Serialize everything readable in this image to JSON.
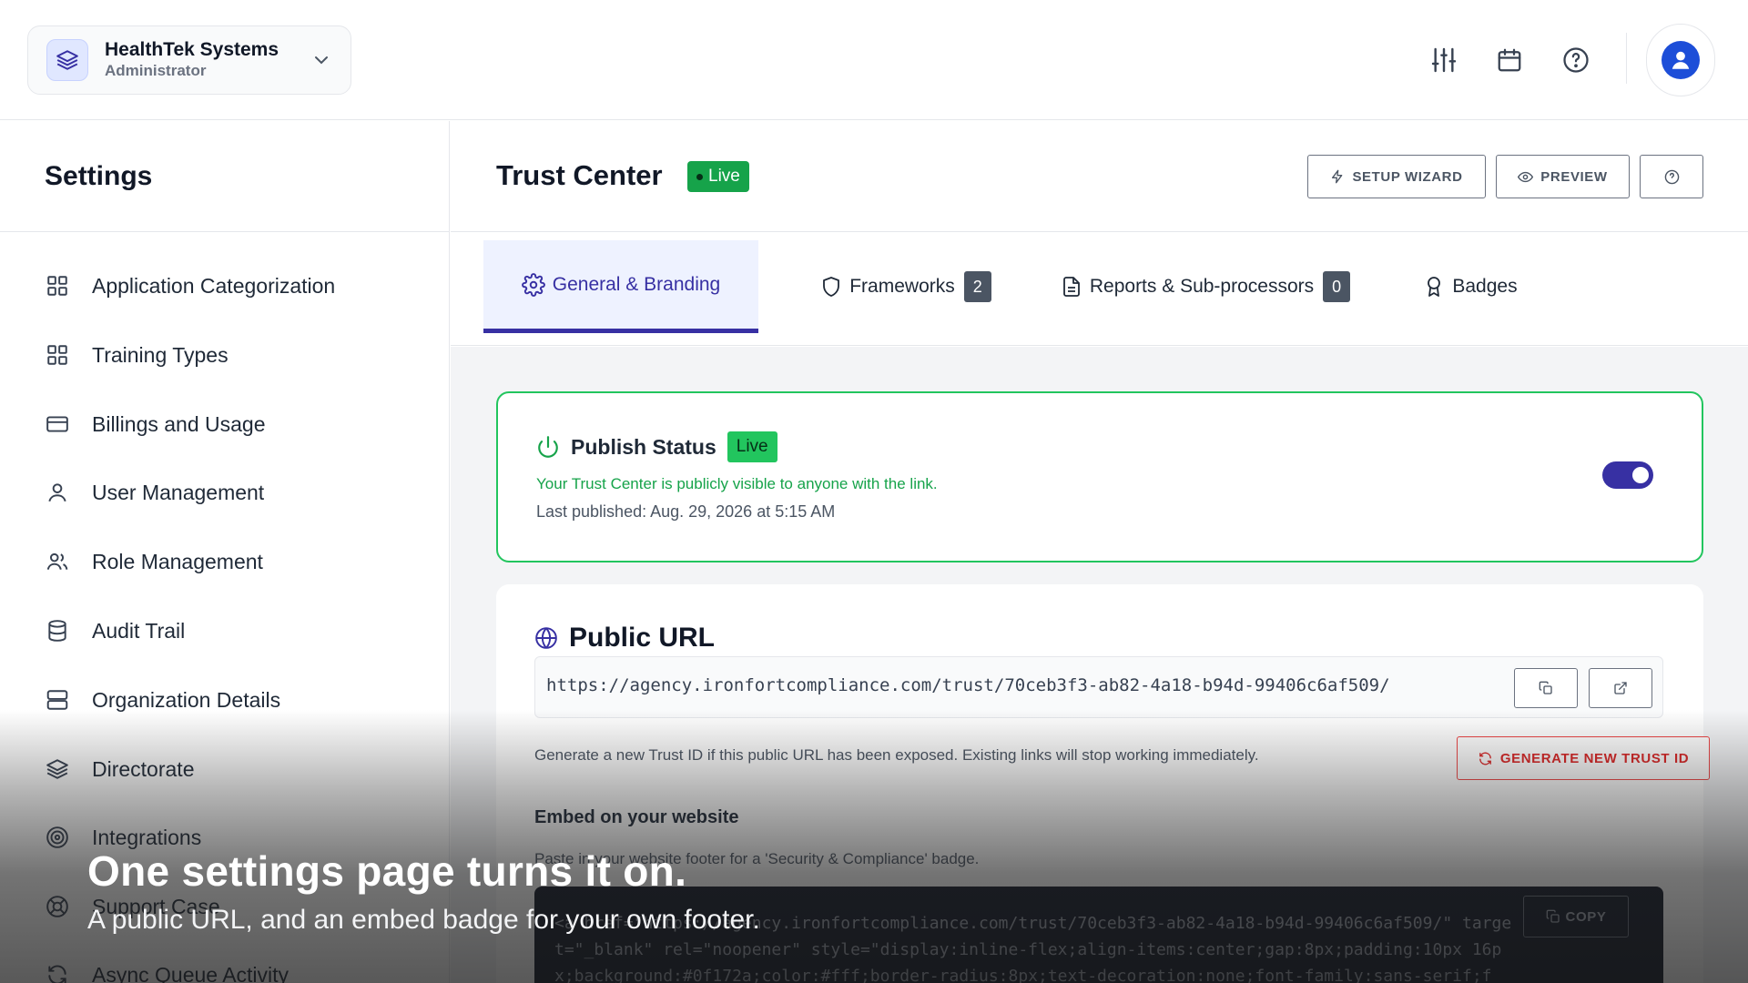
{
  "org": {
    "name": "HealthTek Systems",
    "role": "Administrator"
  },
  "topbar": {
    "icons": [
      "sliders-icon",
      "calendar-icon",
      "help-icon"
    ],
    "avatar": "user-avatar-icon"
  },
  "sidebar": {
    "title": "Settings",
    "items": [
      {
        "label": "Application Categorization",
        "icon": "grid-icon"
      },
      {
        "label": "Training Types",
        "icon": "grid-icon"
      },
      {
        "label": "Billings and Usage",
        "icon": "credit-card-icon"
      },
      {
        "label": "User Management",
        "icon": "user-icon"
      },
      {
        "label": "Role Management",
        "icon": "users-icon"
      },
      {
        "label": "Audit Trail",
        "icon": "database-icon"
      },
      {
        "label": "Organization Details",
        "icon": "server-icon"
      },
      {
        "label": "Directorate",
        "icon": "layers-icon"
      },
      {
        "label": "Integrations",
        "icon": "target-icon"
      },
      {
        "label": "Support Case",
        "icon": "lifebuoy-icon"
      },
      {
        "label": "Async Queue Activity",
        "icon": "refresh-icon"
      }
    ]
  },
  "header": {
    "title": "Trust Center",
    "status": "Live",
    "buttons": {
      "setup_wizard": "SETUP WIZARD",
      "preview": "PREVIEW"
    }
  },
  "tabs": [
    {
      "label": "General & Branding",
      "active": true
    },
    {
      "label": "Frameworks",
      "count": "2"
    },
    {
      "label": "Reports & Sub-processors",
      "count": "0"
    },
    {
      "label": "Badges"
    }
  ],
  "publish": {
    "title": "Publish Status",
    "badge": "Live",
    "description": "Your Trust Center is publicly visible to anyone with the link.",
    "last_published": "Last published: Aug. 29, 2026 at 5:15 AM",
    "enabled": true
  },
  "public_url": {
    "title": "Public URL",
    "url": "https://agency.ironfortcompliance.com/trust/70ceb3f3-ab82-4a18-b94d-99406c6af509/",
    "regenerate_note": "Generate a new Trust ID if this public URL has been exposed. Existing links will stop working immediately.",
    "regenerate_label": "GENERATE NEW TRUST ID",
    "embed_title": "Embed on your website",
    "embed_note": "Paste in your website footer for a 'Security & Compliance' badge.",
    "embed_code": "<a href=\"https://agency.ironfortcompliance.com/trust/70ceb3f3-ab82-4a18-b94d-99406c6af509/\" target=\"_blank\" rel=\"noopener\" style=\"display:inline-flex;align-items:center;gap:8px;padding:10px 16px;background:#0f172a;color:#fff;border-radius:8px;text-decoration:none;font-family:sans-serif;f",
    "copy_label": "COPY"
  },
  "caption": {
    "title": "One settings page turns it on.",
    "subtitle": "A public URL, and an embed badge for your own footer."
  },
  "colors": {
    "accent": "#3730a3",
    "live": "#22c55e",
    "danger": "#ef4444",
    "code_bg": "#111827"
  }
}
